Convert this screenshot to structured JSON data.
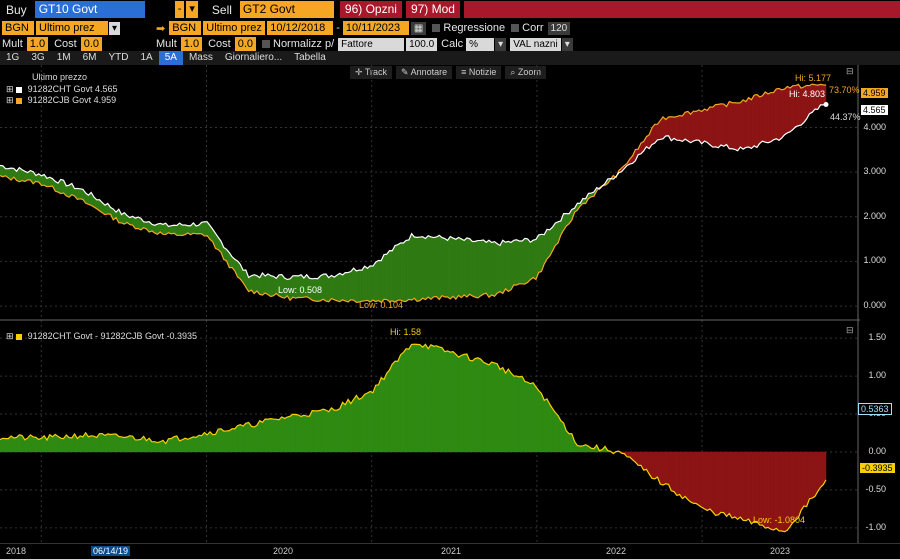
{
  "toolbar": {
    "buy_label": "Buy",
    "buy_security": "GT10 Govt",
    "sell_label": "Sell",
    "sell_security": "GT2 Govt",
    "opzni_label": "96) Opzni",
    "mod_label": "97) Mod",
    "source_left": "BGN",
    "field_left": "Ultimo prez",
    "source_right": "BGN",
    "field_right": "Ultimo prez",
    "date_from": "10/12/2018",
    "date_to": "10/11/2023",
    "regressione_label": "Regressione",
    "corr_label": "Corr",
    "corr_value": "120",
    "mult_left_label": "Mult",
    "mult_left_value": "1.0",
    "cost_left_label": "Cost",
    "cost_left_value": "0.0",
    "mult_right_label": "Mult",
    "mult_right_value": "1.0",
    "cost_right_label": "Cost",
    "cost_right_value": "0.0",
    "normalizz_label": "Normalizz p/",
    "normalizz_value": "Fattore",
    "normalizz_number": "100.0",
    "calc_label": "Calc",
    "calc_value": "%",
    "val_label": "VAL nazni"
  },
  "periods": [
    "1G",
    "3G",
    "1M",
    "6M",
    "YTD",
    "1A",
    "5A",
    "Mass",
    "Giornaliero...",
    "Tabella"
  ],
  "active_period": "5A",
  "chart_tools": [
    "Track",
    "Annotare",
    "Notizie",
    "Zoom"
  ],
  "upper_legend": {
    "title": "Ultimo prezzo",
    "series": [
      {
        "label": "91282CHT Govt 4.565",
        "color": "#ffffff"
      },
      {
        "label": "91282CJB Govt 4.959",
        "color": "#f5a623"
      }
    ]
  },
  "lower_legend": {
    "label": "91282CHT Govt - 91282CJB Govt -0.3935",
    "color": "#f5d000"
  },
  "upper_yticks": [
    "4.000",
    "3.000",
    "2.000",
    "1.000",
    "0.000"
  ],
  "lower_yticks": [
    "1.50",
    "1.00",
    "0.50",
    "0.00",
    "-0.50",
    "-1.00"
  ],
  "upper_tags": {
    "orange_last": "4.959",
    "white_last": "4.565"
  },
  "lower_tags": {
    "pct_tag": "0.5363",
    "last_tag": "-0.3935"
  },
  "annotations": {
    "hi_orange": "Hi: 5.177",
    "hi_white": "Hi: 4.803",
    "pct_high": "73.70%",
    "pct_low": "44.37%",
    "low_white": "Low: 0.508",
    "low_orange": "Low: 0.104",
    "spread_hi": "Hi: 1.58",
    "spread_low": "Low: -1.0804"
  },
  "x_labels": [
    "2018",
    "06/14/19",
    "2020",
    "2021",
    "2022",
    "2023"
  ],
  "chart_data": [
    {
      "type": "line",
      "title": "Ultimo prezzo",
      "x": [
        "2018-10",
        "2019-01",
        "2019-04",
        "2019-07",
        "2019-10",
        "2020-01",
        "2020-03",
        "2020-06",
        "2020-09",
        "2020-12",
        "2021-03",
        "2021-06",
        "2021-09",
        "2021-12",
        "2022-03",
        "2022-06",
        "2022-09",
        "2022-12",
        "2023-03",
        "2023-06",
        "2023-10"
      ],
      "series": [
        {
          "name": "91282CHT Govt",
          "values": [
            3.15,
            2.95,
            2.6,
            2.05,
            1.8,
            1.85,
            0.7,
            0.65,
            0.68,
            0.92,
            1.6,
            1.5,
            1.4,
            1.5,
            2.3,
            3.0,
            3.8,
            3.65,
            3.5,
            3.8,
            4.565
          ]
        },
        {
          "name": "91282CJB Govt",
          "values": [
            2.9,
            2.75,
            2.35,
            1.85,
            1.6,
            1.6,
            0.35,
            0.18,
            0.14,
            0.12,
            0.15,
            0.2,
            0.25,
            0.65,
            2.2,
            3.0,
            4.2,
            4.4,
            4.6,
            4.9,
            4.959
          ]
        }
      ],
      "ylim": [
        -0.2,
        5.4
      ]
    },
    {
      "type": "area",
      "title": "91282CHT Govt - 91282CJB Govt",
      "x": [
        "2018-10",
        "2019-01",
        "2019-04",
        "2019-07",
        "2019-10",
        "2020-01",
        "2020-03",
        "2020-06",
        "2020-09",
        "2020-12",
        "2021-03",
        "2021-06",
        "2021-09",
        "2021-12",
        "2022-03",
        "2022-06",
        "2022-09",
        "2022-12",
        "2023-03",
        "2023-06",
        "2023-10"
      ],
      "series": [
        {
          "name": "91282CHT Govt - 91282CJB Govt",
          "values": [
            0.2,
            0.18,
            0.22,
            0.2,
            0.15,
            0.25,
            0.35,
            0.47,
            0.55,
            0.8,
            1.45,
            1.3,
            1.15,
            0.85,
            0.1,
            -0.0,
            -0.4,
            -0.75,
            -0.9,
            -1.05,
            -0.3935
          ]
        }
      ],
      "ylim": [
        -1.2,
        1.7
      ]
    }
  ]
}
